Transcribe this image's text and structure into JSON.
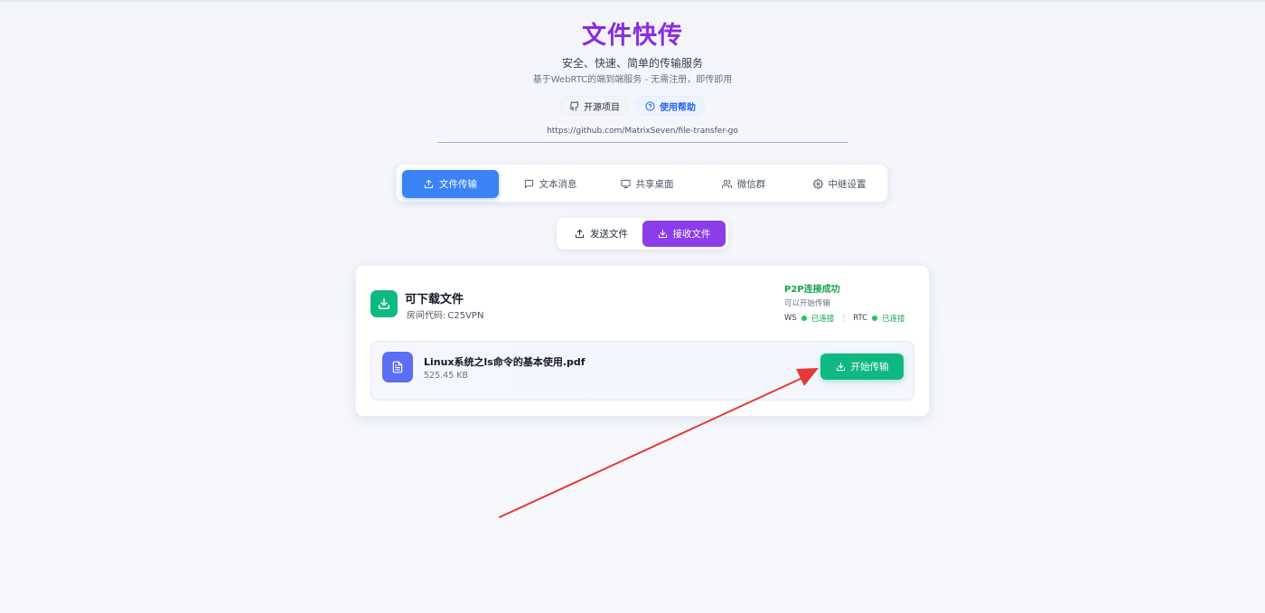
{
  "header": {
    "title": "文件快传",
    "subtitle": "安全、快速、简单的传输服务",
    "description": "基于WebRTC的端到端服务 - 无需注册，即传即用"
  },
  "links": {
    "open_source_label": "开源项目",
    "help_label": "使用帮助",
    "repo_url": "https://github.com/MatrixSeven/file-transfer-go"
  },
  "nav": {
    "tabs": [
      {
        "label": "文件传输",
        "icon": "upload-icon",
        "active": true
      },
      {
        "label": "文本消息",
        "icon": "message-icon",
        "active": false
      },
      {
        "label": "共享桌面",
        "icon": "monitor-icon",
        "active": false
      },
      {
        "label": "微信群",
        "icon": "users-icon",
        "active": false
      },
      {
        "label": "中继设置",
        "icon": "gear-icon",
        "active": false
      }
    ]
  },
  "mode": {
    "send_label": "发送文件",
    "receive_label": "接收文件",
    "active": "receive"
  },
  "panel": {
    "title": "可下载文件",
    "room_code_label": "房间代码:",
    "room_code": "C25VPN",
    "status": {
      "title": "P2P连接成功",
      "subtitle": "可以开始传输",
      "ws_label": "WS",
      "ws_value": "已连接",
      "rtc_label": "RTC",
      "rtc_value": "已连接",
      "separator": "|"
    },
    "file": {
      "name": "Linux系统之ls命令的基本使用.pdf",
      "size": "525.45 KB",
      "action_label": "开始传输"
    }
  },
  "colors": {
    "title": "#8a2be2",
    "nav_active": "#3b82f6",
    "mode_active": "#8b3dea",
    "success": "#10b981",
    "file_icon": "#5b6ef5",
    "annotation_arrow": "#e53935"
  }
}
